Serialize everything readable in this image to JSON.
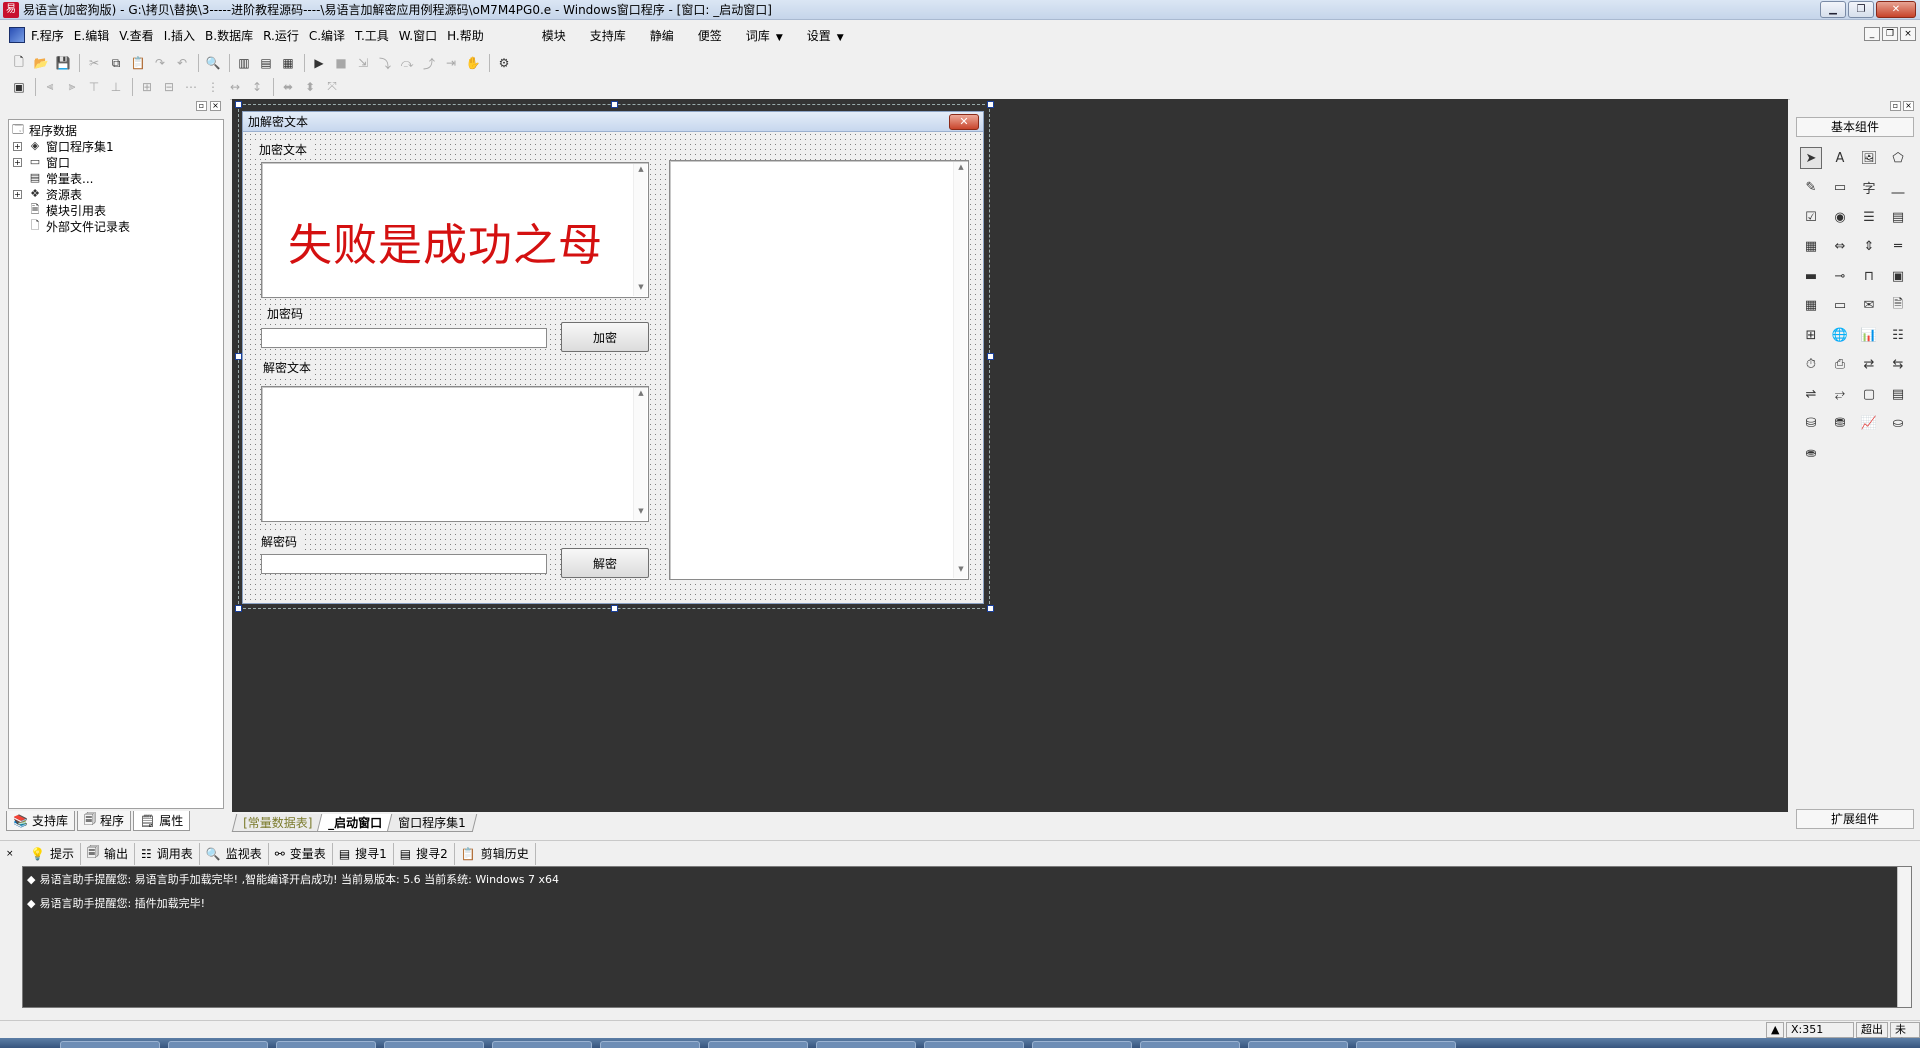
{
  "window": {
    "title": "易语言(加密狗版) - G:\\拷贝\\替换\\3-----进阶教程源码----\\易语言加解密应用例程源码\\oM7M4PG0.e - Windows窗口程序 - [窗口: _启动窗口]",
    "minimize": "▁",
    "restore": "❐",
    "close": "✕"
  },
  "menu": {
    "items": [
      "F.程序",
      "E.编辑",
      "V.查看",
      "I.插入",
      "B.数据库",
      "R.运行",
      "C.编译",
      "T.工具",
      "W.窗口",
      "H.帮助"
    ],
    "right_items": [
      "模块",
      "支持库",
      "静编",
      "便签",
      "词库",
      "设置"
    ],
    "mdi_min": "_",
    "mdi_restore": "❐",
    "mdi_close": "×"
  },
  "left_panel": {
    "tree": {
      "root": "程序数据",
      "items": [
        "窗口程序集1",
        "窗口",
        "常量表...",
        "资源表",
        "模块引用表",
        "外部文件记录表"
      ]
    },
    "tabs": [
      "支持库",
      "程序",
      "属性"
    ]
  },
  "form": {
    "caption": "加解密文本",
    "label_encrypt_text": "加密文本",
    "encrypt_content": "失败是成功之母",
    "label_encrypt_code": "加密码",
    "encrypt_button": "加密",
    "label_decrypt_text": "解密文本",
    "label_decrypt_code": "解密码",
    "decrypt_button": "解密"
  },
  "workspace_tabs": [
    "[常量数据表]",
    "_启动窗口",
    "窗口程序集1"
  ],
  "right_panel": {
    "title": "基本组件",
    "footer": "扩展组件",
    "components": [
      "pointer",
      "label",
      "picture",
      "shape",
      "edit",
      "frame",
      "text",
      "line",
      "checkbox",
      "radio",
      "listbox",
      "combobox",
      "grid",
      "scroll",
      "vscroll",
      "hscroll",
      "progress",
      "slider",
      "tabs",
      "imagebox",
      "timer-grid",
      "status",
      "stamp",
      "page",
      "table",
      "globe",
      "chart",
      "list-alt",
      "timer",
      "printer",
      "transfer",
      "transfer2",
      "net1",
      "net2",
      "window",
      "layout",
      "db1",
      "db2",
      "db-chart",
      "odbc",
      "odbc-link"
    ]
  },
  "output": {
    "tabs": [
      "提示",
      "输出",
      "调用表",
      "监视表",
      "变量表",
      "搜寻1",
      "搜寻2",
      "剪辑历史"
    ],
    "lines": [
      "易语言助手提醒您: 易语言助手加载完毕! ,智能编译开启成功! 当前易版本: 5.6 当前系统: Windows 7 x64",
      "易语言助手提醒您: 插件加载完毕!"
    ]
  },
  "status": {
    "coord": "X:351",
    "overwrite": "超出",
    "modified": "未改"
  }
}
